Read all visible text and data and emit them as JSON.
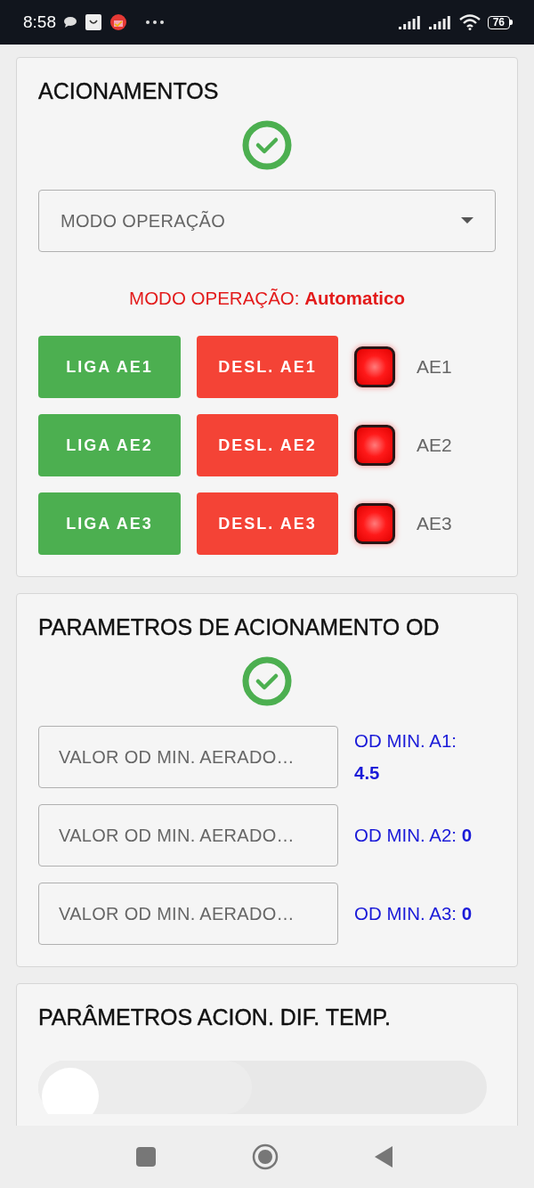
{
  "status_bar": {
    "time": "8:58",
    "battery": "76"
  },
  "acionamentos": {
    "title": "ACIONAMENTOS",
    "status_ok": true,
    "mode_select": {
      "placeholder": "MODO OPERAÇÃO"
    },
    "mode_text": "MODO OPERAÇÃO: **Automatico**",
    "rows": [
      {
        "on_button": "LIGA AE1",
        "off_button": "DESL. AE1",
        "on": false,
        "label": "AE1"
      },
      {
        "on_button": "LIGA AE2",
        "off_button": "DESL. AE2",
        "on": false,
        "label": "AE2"
      },
      {
        "on_button": "LIGA AE3",
        "off_button": "DESL. AE3",
        "on": false,
        "label": "AE3"
      }
    ]
  },
  "parametros_od": {
    "title": "PARAMETROS DE ACIONAMENTO OD",
    "status_ok": true,
    "fields": [
      {
        "placeholder": "VALOR OD MIN. AERADO…",
        "reading": "OD MIN. A1: **4.5**"
      },
      {
        "placeholder": "VALOR OD MIN. AERADO…",
        "reading": "OD MIN. A2: **0**"
      },
      {
        "placeholder": "VALOR OD MIN. AERADO…",
        "reading": "OD MIN. A3: **0**"
      }
    ]
  },
  "parametros_temp": {
    "title": "PARÂMETROS ACION. DIF. TEMP."
  }
}
